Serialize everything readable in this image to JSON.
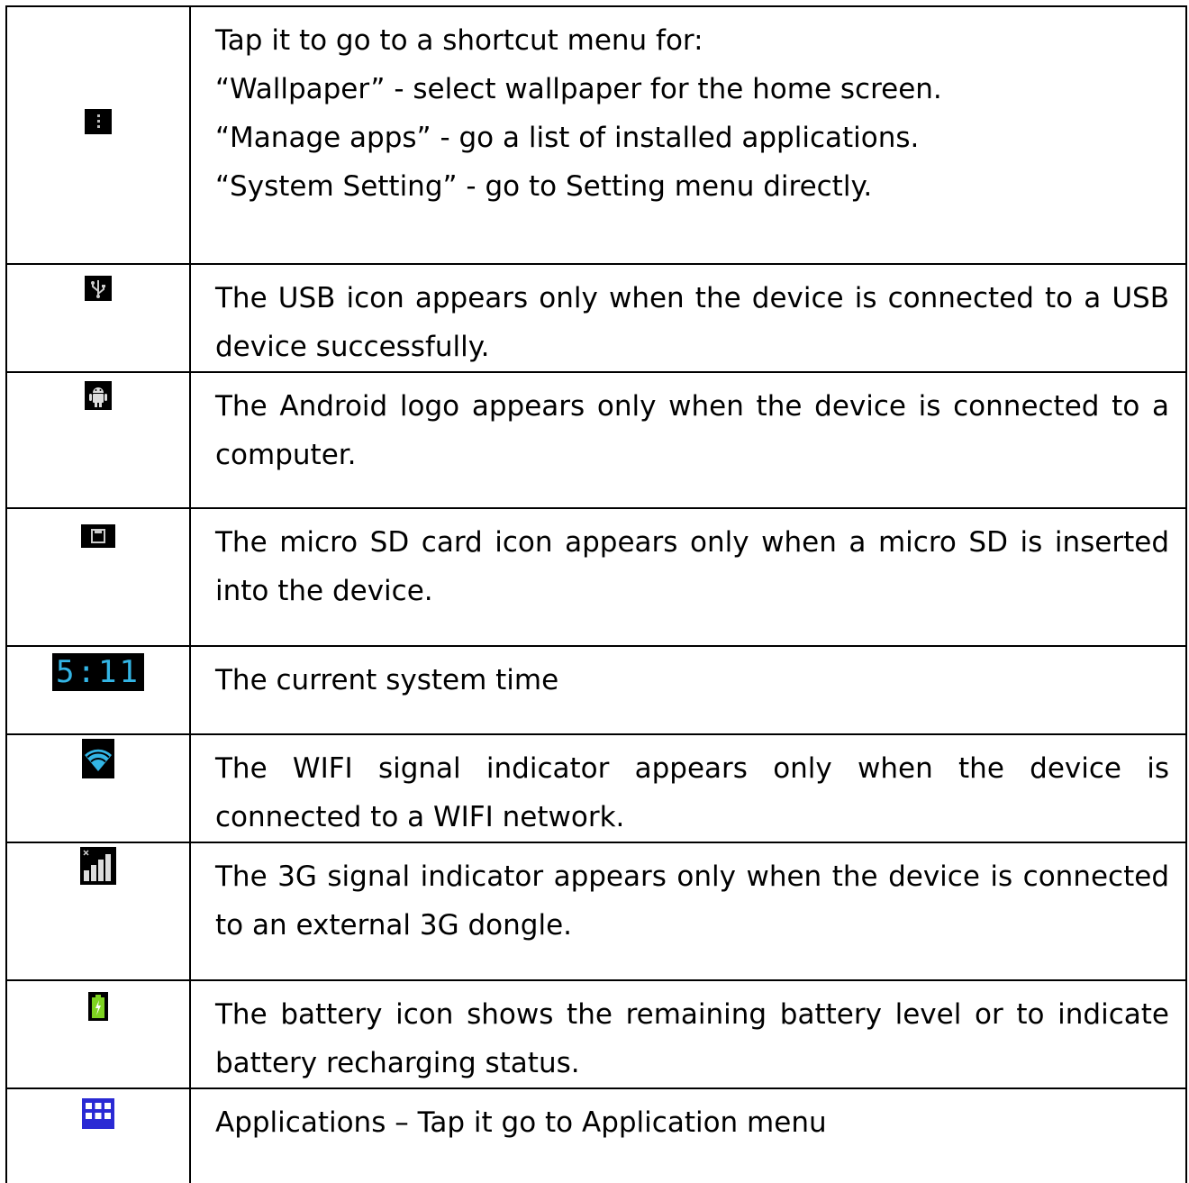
{
  "rows": [
    {
      "icon": "menu-dots-icon",
      "lines": [
        "Tap it to go to a shortcut menu for:",
        "“Wallpaper” - select wallpaper for the home screen.",
        "“Manage apps” - go a list of installed applications.",
        "“System Setting” - go to Setting menu directly."
      ]
    },
    {
      "icon": "usb-icon",
      "text": "The USB icon appears only when the device is connected to a USB device successfully."
    },
    {
      "icon": "android-logo-icon",
      "text": "The Android logo appears only when the device is connected to a computer."
    },
    {
      "icon": "micro-sd-card-icon",
      "text": "The micro SD card icon appears only when a micro SD is inserted into the device."
    },
    {
      "icon": "clock-time-display",
      "icon_text": "5:11",
      "text": "The current system time"
    },
    {
      "icon": "wifi-signal-icon",
      "text": "The WIFI signal indicator appears only when the device is connected to a WIFI network."
    },
    {
      "icon": "3g-signal-icon",
      "text": "The 3G signal indicator appears only when the device is connected to an external 3G dongle."
    },
    {
      "icon": "battery-charging-icon",
      "text": "The battery icon shows the remaining battery level or to indicate battery recharging status."
    },
    {
      "icon": "applications-grid-icon",
      "text": "Applications – Tap it go to Application menu"
    }
  ],
  "colors": {
    "icon_bg": "#000000",
    "android_blue": "#33b5e5",
    "battery_green": "#7ed321",
    "apps_blue": "#2a2ad4"
  }
}
